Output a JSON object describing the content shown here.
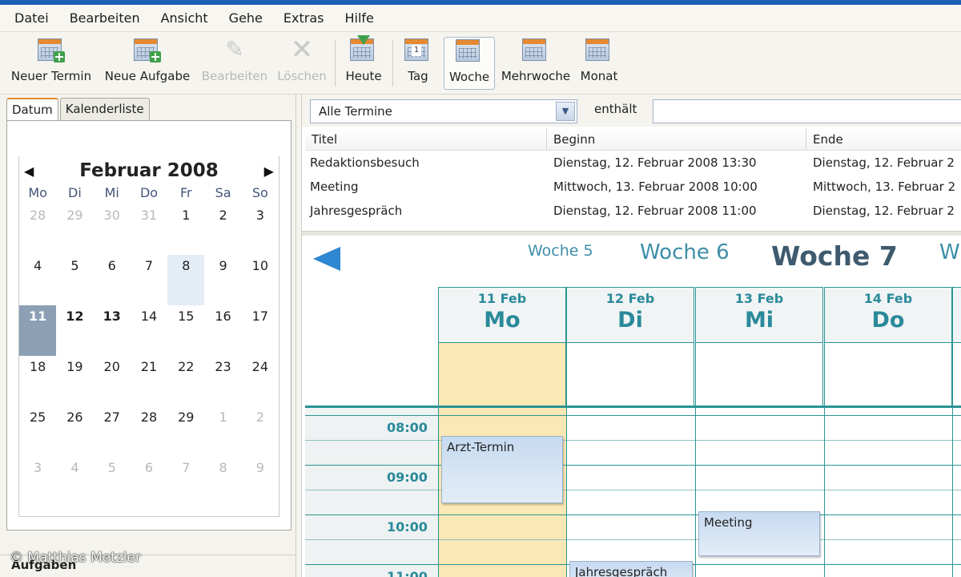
{
  "menu": [
    "Datei",
    "Bearbeiten",
    "Ansicht",
    "Gehe",
    "Extras",
    "Hilfe"
  ],
  "toolbar": {
    "new_appointment": "Neuer Termin",
    "new_task": "Neue Aufgabe",
    "edit": "Bearbeiten",
    "delete": "Löschen",
    "today": "Heute",
    "day": "Tag",
    "week": "Woche",
    "multiweek": "Mehrwoche",
    "month": "Monat",
    "day_icon_number": "1"
  },
  "left": {
    "tabs": [
      "Datum",
      "Kalenderliste"
    ],
    "month_title": "Februar  2008",
    "weekdays": [
      "Mo",
      "Di",
      "Mi",
      "Do",
      "Fr",
      "Sa",
      "So"
    ],
    "days": [
      "28",
      "29",
      "30",
      "31",
      "1",
      "2",
      "3",
      "4",
      "5",
      "6",
      "7",
      "8",
      "9",
      "10",
      "11",
      "12",
      "13",
      "14",
      "15",
      "16",
      "17",
      "18",
      "19",
      "20",
      "21",
      "22",
      "23",
      "24",
      "25",
      "26",
      "27",
      "28",
      "29",
      "1",
      "2",
      "3",
      "4",
      "5",
      "6",
      "7",
      "8",
      "9"
    ],
    "tasks_label": "Aufgaben"
  },
  "filter": {
    "selected": "Alle Termine",
    "contains_label": "enthält",
    "search_value": ""
  },
  "list": {
    "headers": [
      "Titel",
      "Beginn",
      "Ende"
    ],
    "rows": [
      [
        "Redaktionsbesuch",
        "Dienstag, 12. Februar 2008 13:30",
        "Dienstag, 12. Februar 2"
      ],
      [
        "Meeting",
        "Mittwoch, 13. Februar 2008 10:00",
        "Mittwoch, 13. Februar 2"
      ],
      [
        "Jahresgespräch",
        "Dienstag, 12. Februar 2008 11:00",
        "Dienstag, 12. Februar 2"
      ]
    ]
  },
  "weeknav": {
    "w5": "Woche 5",
    "w6": "Woche 6",
    "w7": "Woche 7",
    "w8": "W"
  },
  "columns": [
    {
      "date": "11 Feb",
      "day": "Mo"
    },
    {
      "date": "12 Feb",
      "day": "Di"
    },
    {
      "date": "13 Feb",
      "day": "Mi"
    },
    {
      "date": "14 Feb",
      "day": "Do"
    }
  ],
  "times": [
    "08:00",
    "09:00",
    "10:00",
    "11:00"
  ],
  "appointments": {
    "a1": "Arzt-Termin",
    "a2": "Meeting",
    "a3": "Jahresgespräch"
  },
  "watermark": "© Matthias Metzler",
  "colors": {
    "accent": "#2a9494",
    "today": "#fbe8b4",
    "selected_day": "#8c9fb4"
  }
}
